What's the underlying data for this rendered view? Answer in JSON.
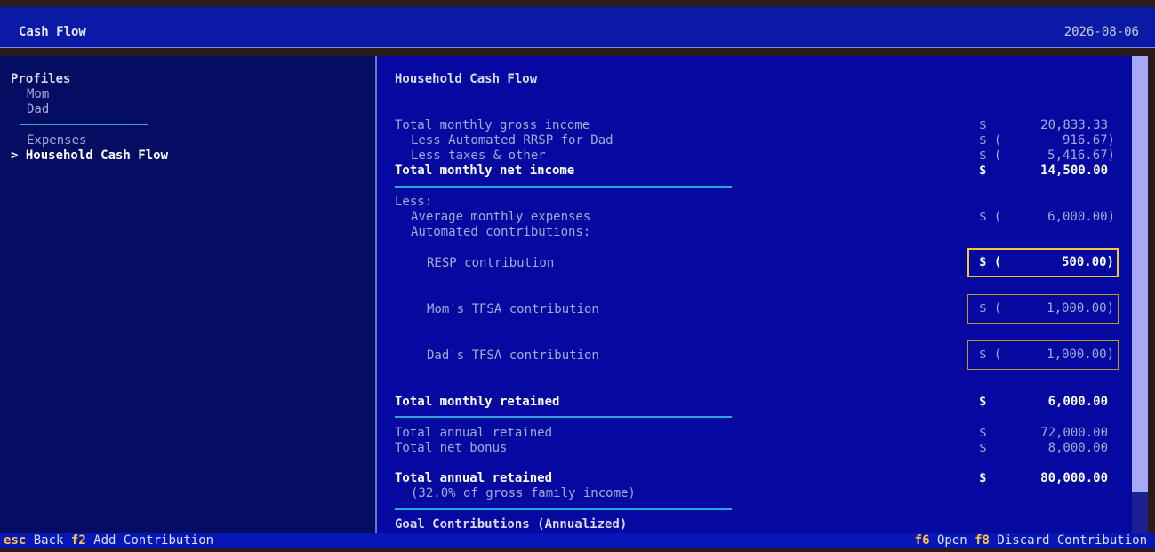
{
  "header": {
    "title": "Cash Flow",
    "date": "2026-08-06"
  },
  "sidebar": {
    "section_label": "Profiles",
    "profiles": [
      "Mom",
      "Dad"
    ],
    "items": [
      {
        "label": "Expenses",
        "selected": false
      },
      {
        "label": "> Household Cash Flow",
        "selected": true
      }
    ]
  },
  "main": {
    "heading": "Household Cash Flow",
    "income": {
      "gross_label": "Total monthly gross income",
      "gross_value": "20,833.33",
      "rrsp_label": "Less Automated RRSP for Dad",
      "rrsp_value": "916.67)",
      "taxes_label": "Less taxes & other",
      "taxes_value": "5,416.67)",
      "net_label": "Total monthly net income",
      "net_value": "14,500.00"
    },
    "less": {
      "label": "Less:",
      "expenses_label": "Average monthly expenses",
      "expenses_value": "6,000.00)",
      "automated_label": "Automated contributions:"
    },
    "contributions": [
      {
        "label": "RESP contribution",
        "value": "500.00)",
        "focused": true
      },
      {
        "label": "Mom's TFSA contribution",
        "value": "1,000.00)",
        "focused": false
      },
      {
        "label": "Dad's TFSA contribution",
        "value": "1,000.00)",
        "focused": false
      }
    ],
    "retained": {
      "monthly_label": "Total monthly retained",
      "monthly_value": "6,000.00",
      "annual_label": "Total annual retained",
      "annual_value": "72,000.00",
      "bonus_label": "Total net bonus",
      "bonus_value": "8,000.00",
      "total_annual_label": "Total annual retained",
      "total_annual_value": "80,000.00",
      "percent_note": "(32.0% of gross family income)"
    },
    "goals_heading": "Goal Contributions (Annualized)",
    "currency_symbol": "$",
    "negative_prefix": "$ ("
  },
  "footer": {
    "left": [
      {
        "key": "esc",
        "label": "Back"
      },
      {
        "key": "f2",
        "label": "Add Contribution"
      }
    ],
    "right": [
      {
        "key": "f6",
        "label": "Open"
      },
      {
        "key": "f8",
        "label": "Discard Contribution"
      }
    ]
  },
  "colors": {
    "accent_key": "#ffc53a",
    "focus_border": "#f0c83a",
    "rule": "#2fa6d8",
    "main_bg": "#0509a0",
    "sidebar_bg": "#050d63"
  }
}
